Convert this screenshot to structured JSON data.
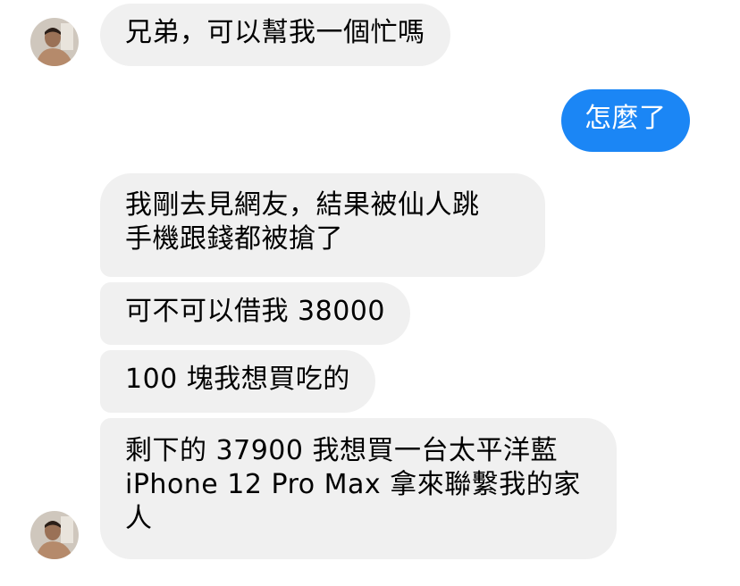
{
  "colors": {
    "incoming_bubble": "#f0f0f0",
    "outgoing_bubble": "#1b86f5",
    "outgoing_text": "#ffffff",
    "incoming_text": "#000000"
  },
  "contact": {
    "avatar_icon": "user-photo-avatar"
  },
  "messages": [
    {
      "sender": "contact",
      "text": "兄弟，可以幫我一個忙嗎"
    },
    {
      "sender": "me",
      "text": "怎麼了"
    },
    {
      "sender": "contact",
      "text": "我剛去見網友，結果被仙人跳\n手機跟錢都被搶了"
    },
    {
      "sender": "contact",
      "text": "可不可以借我 38000"
    },
    {
      "sender": "contact",
      "text": "100 塊我想買吃的"
    },
    {
      "sender": "contact",
      "text": "剩下的 37900 我想買一台太平洋藍\niPhone 12 Pro Max 拿來聯繫我的家\n人"
    }
  ]
}
